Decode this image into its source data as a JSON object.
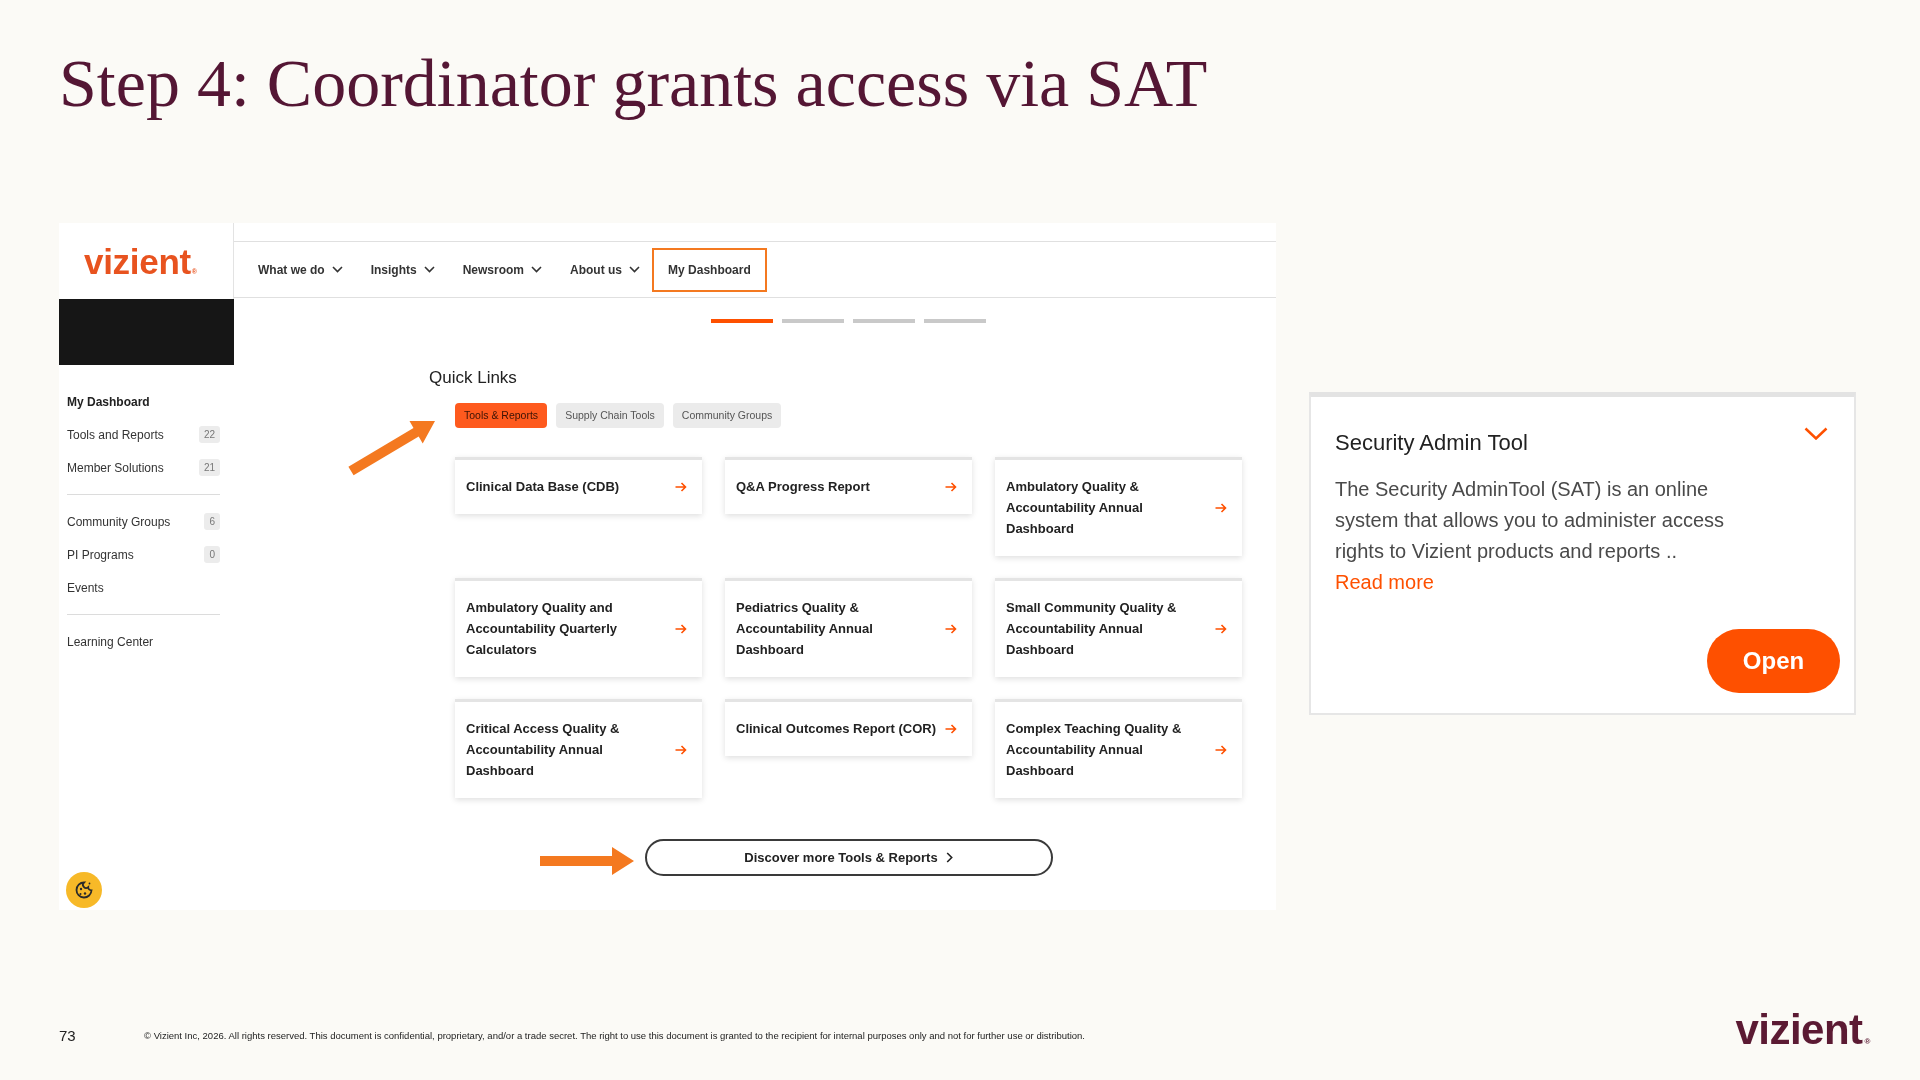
{
  "slide": {
    "title": "Step 4: Coordinator grants access via SAT"
  },
  "website": {
    "logo": {
      "text": "vizient",
      "mark": "®"
    },
    "nav": [
      {
        "label": "What we do",
        "dropdown": true,
        "highlighted": false
      },
      {
        "label": "Insights",
        "dropdown": true,
        "highlighted": false
      },
      {
        "label": "Newsroom",
        "dropdown": true,
        "highlighted": false
      },
      {
        "label": "About us",
        "dropdown": true,
        "highlighted": false
      },
      {
        "label": "My Dashboard",
        "dropdown": false,
        "highlighted": true
      }
    ],
    "carousel_indicators": [
      {
        "selected": true
      },
      {
        "selected": false
      },
      {
        "selected": false
      },
      {
        "selected": false
      }
    ],
    "sidebar": {
      "groups": [
        {
          "items": [
            {
              "label": "My Dashboard",
              "selected": true
            },
            {
              "label": "Tools and Reports",
              "count": "22",
              "selected": false
            },
            {
              "label": "Member Solutions",
              "count": "21",
              "selected": false
            }
          ]
        },
        {
          "items": [
            {
              "label": "Community Groups",
              "count": "6",
              "selected": false
            },
            {
              "label": "PI Programs",
              "count": "0",
              "selected": false
            },
            {
              "label": "Events",
              "selected": false
            }
          ]
        },
        {
          "items": [
            {
              "label": "Learning Center",
              "selected": false
            }
          ]
        }
      ]
    },
    "quick_links": {
      "title": "Quick Links",
      "tabs": [
        {
          "label": "Tools & Reports",
          "selected": true
        },
        {
          "label": "Supply Chain Tools",
          "selected": false
        },
        {
          "label": "Community Groups",
          "selected": false
        }
      ],
      "cards": [
        {
          "title": "Clinical Data Base (CDB)"
        },
        {
          "title": "Q&A Progress Report"
        },
        {
          "title": "Ambulatory Quality & Accountability Annual Dashboard"
        },
        {
          "title": "Ambulatory Quality and Accountability Quarterly Calculators"
        },
        {
          "title": "Pediatrics Quality & Accountability Annual Dashboard"
        },
        {
          "title": "Small Community Quality & Accountability Annual Dashboard"
        },
        {
          "title": "Critical Access Quality & Accountability Annual Dashboard"
        },
        {
          "title": "Clinical Outcomes Report (COR)"
        },
        {
          "title": "Complex Teaching Quality & Accountability Annual Dashboard"
        }
      ],
      "more_button": "Discover more Tools & Reports"
    }
  },
  "sat_card": {
    "title": "Security Admin Tool",
    "description": "The Security AdminTool (SAT) is an online system that allows you to administer access rights to Vizient products and reports ..",
    "link": "Read more",
    "button": "Open"
  },
  "footer": {
    "page_number": "73",
    "copyright": "© Vizient Inc, 2026. All rights reserved. This document is confidential, proprietary, and/or a trade secret. The right to use this document is granted to the recipient for internal purposes only and not for further use or distribution.",
    "logo": {
      "text": "vizient",
      "mark": "®"
    }
  }
}
